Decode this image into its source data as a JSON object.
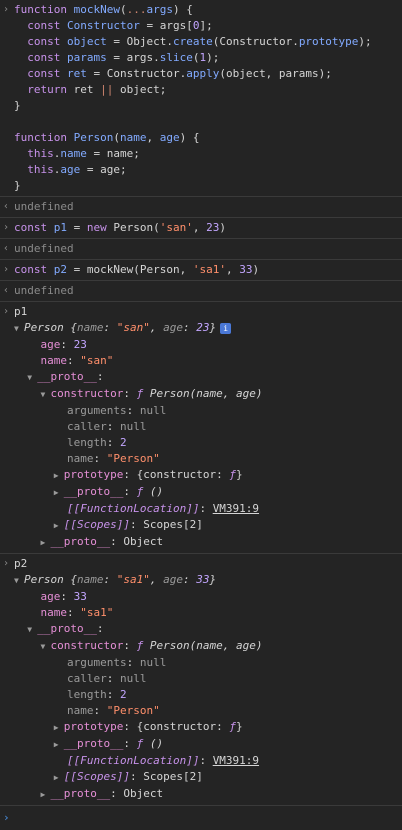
{
  "gutter": {
    "input": "›",
    "output": "‹",
    "prompt": "›"
  },
  "code": {
    "l1": {
      "a": "function ",
      "b": "mockNew",
      "c": "(",
      "d": "...",
      "e": "args",
      "f": ") {"
    },
    "l2": {
      "a": "  const ",
      "b": "Constructor",
      "c": " = args[",
      "d": "0",
      "e": "];"
    },
    "l3": {
      "a": "  const ",
      "b": "object",
      "c": " = Object.",
      "d": "create",
      "e": "(Constructor.",
      "f": "prototype",
      "g": ");"
    },
    "l4": {
      "a": "  const ",
      "b": "params",
      "c": " = args.",
      "d": "slice",
      "e": "(",
      "f": "1",
      "g": ");"
    },
    "l5": {
      "a": "  const ",
      "b": "ret",
      "c": " = Constructor.",
      "d": "apply",
      "e": "(object, params);"
    },
    "l6": {
      "a": "  return ",
      "b": "ret ",
      "c": "||",
      "d": " object;"
    },
    "l7": "}",
    "l8": {
      "a": "function ",
      "b": "Person",
      "c": "(",
      "d": "name",
      "e": ", ",
      "f": "age",
      "g": ") {"
    },
    "l9": {
      "a": "  this",
      "b": ".",
      "c": "name",
      "d": " = name;"
    },
    "l10": {
      "a": "  this",
      "b": ".",
      "c": "age",
      "d": " = age;"
    },
    "l11": "}"
  },
  "results": {
    "undef": "undefined"
  },
  "stmt1": {
    "a": "const ",
    "b": "p1",
    "c": " = ",
    "d": "new ",
    "e": "Person(",
    "f": "'san'",
    "g": ", ",
    "h": "23",
    "i": ")"
  },
  "stmt2": {
    "a": "const ",
    "b": "p2",
    "c": " = mockNew(Person, ",
    "d": "'sa1'",
    "e": ", ",
    "f": "33",
    "g": ")"
  },
  "p1": {
    "name": "p1",
    "summary": {
      "cls": "Person ",
      "o": "{",
      "k1": "name",
      "c1": ": ",
      "v1": "\"san\"",
      "sep": ", ",
      "k2": "age",
      "c2": ": ",
      "v2": "23",
      "cl": "}"
    },
    "info": "i",
    "age_k": "age",
    "age_v": "23",
    "name_k": "name",
    "name_v": "\"san\"",
    "proto": "__proto__",
    "ctor_k": "constructor",
    "ctor_f": "ƒ",
    "ctor_sig": "Person(name, age)",
    "args_k": "arguments",
    "args_v": "null",
    "caller_k": "caller",
    "caller_v": "null",
    "len_k": "length",
    "len_v": "2",
    "nm_k": "name",
    "nm_v": "\"Person\"",
    "prot_k": "prototype",
    "prot_v": "{constructor: ",
    "prot_f": "ƒ",
    "prot_c": "}",
    "pr_k": "__proto__",
    "pr_f": "ƒ",
    "pr_v": "()",
    "loc_k": "[[FunctionLocation]]",
    "loc_v": "VM391:9",
    "sc_k": "[[Scopes]]",
    "sc_v": "Scopes[2]",
    "obj_k": "__proto__",
    "obj_v": "Object"
  },
  "p2": {
    "name": "p2",
    "summary": {
      "cls": "Person ",
      "o": "{",
      "k1": "name",
      "c1": ": ",
      "v1": "\"sa1\"",
      "sep": ", ",
      "k2": "age",
      "c2": ": ",
      "v2": "33",
      "cl": "}"
    },
    "age_k": "age",
    "age_v": "33",
    "name_k": "name",
    "name_v": "\"sa1\"",
    "proto": "__proto__",
    "ctor_k": "constructor",
    "ctor_f": "ƒ",
    "ctor_sig": "Person(name, age)",
    "args_k": "arguments",
    "args_v": "null",
    "caller_k": "caller",
    "caller_v": "null",
    "len_k": "length",
    "len_v": "2",
    "nm_k": "name",
    "nm_v": "\"Person\"",
    "prot_k": "prototype",
    "prot_v": "{constructor: ",
    "prot_f": "ƒ",
    "prot_c": "}",
    "pr_k": "__proto__",
    "pr_f": "ƒ",
    "pr_v": "()",
    "loc_k": "[[FunctionLocation]]",
    "loc_v": "VM391:9",
    "sc_k": "[[Scopes]]",
    "sc_v": "Scopes[2]",
    "obj_k": "__proto__",
    "obj_v": "Object"
  },
  "tri": {
    "open": "▼",
    "closed": "▶"
  }
}
